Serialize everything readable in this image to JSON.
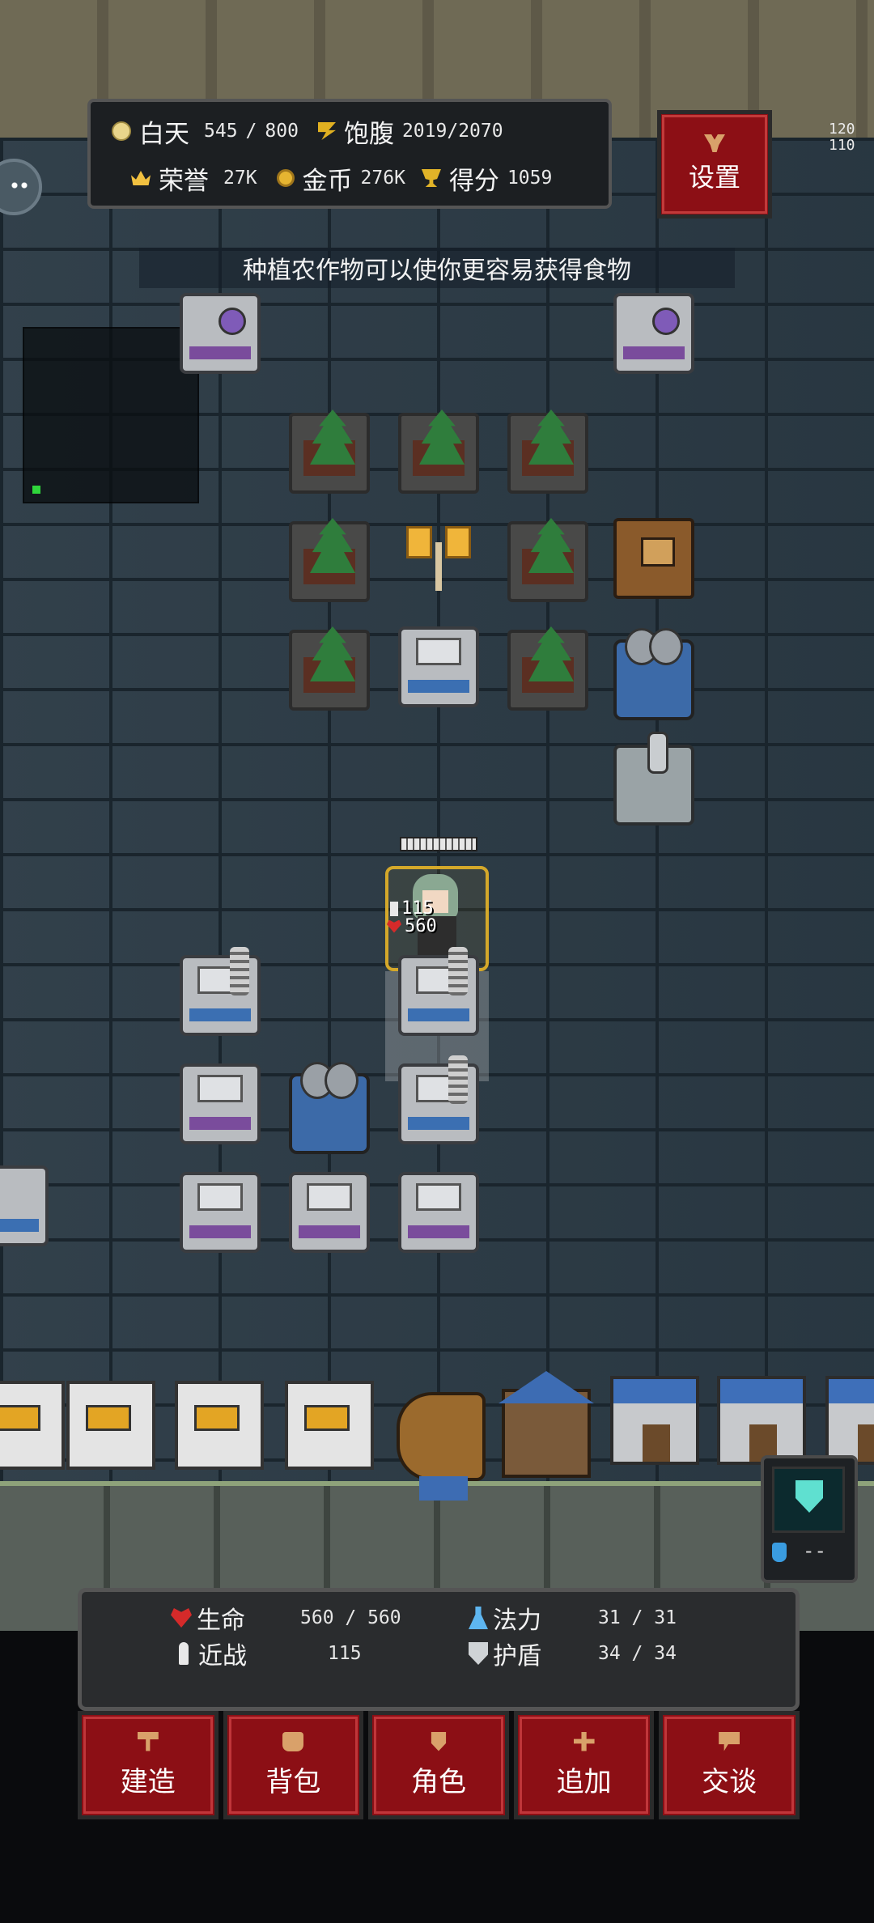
{
  "hud_top": {
    "daytime": {
      "label": "白天",
      "current": "545",
      "max": "800",
      "icon": "sun-icon"
    },
    "satiety": {
      "label": "饱腹",
      "value": "2019/2070",
      "icon": "food-icon"
    },
    "honor": {
      "label": "荣誉",
      "value": "27K",
      "icon": "crown-icon"
    },
    "gold": {
      "label": "金币",
      "value": "276K",
      "icon": "coin-icon"
    },
    "score": {
      "label": "得分",
      "value": "1059",
      "icon": "trophy-icon"
    }
  },
  "settings_button": {
    "label": "设置",
    "icon": "wrench-icon"
  },
  "tip": "种植农作物可以使你更容易获得食物",
  "right_edge": {
    "line1": "120",
    "line2": "110"
  },
  "player": {
    "attack": "115",
    "hp": "560"
  },
  "shield_widget": {
    "icon": "shield-icon",
    "potion_icon": "potion-icon",
    "value": "--"
  },
  "stats": {
    "hp": {
      "label": "生命",
      "value": "560 / 560",
      "icon": "heart-icon"
    },
    "mana": {
      "label": "法力",
      "value": "31 / 31",
      "icon": "flask-icon"
    },
    "melee": {
      "label": "近战",
      "value": "115",
      "icon": "sword-icon"
    },
    "shield": {
      "label": "护盾",
      "value": "34 / 34",
      "icon": "shield-icon"
    }
  },
  "menu": [
    {
      "label": "建造",
      "icon": "hammer-icon"
    },
    {
      "label": "背包",
      "icon": "bag-icon"
    },
    {
      "label": "角色",
      "icon": "character-icon"
    },
    {
      "label": "追加",
      "icon": "plus-icon"
    },
    {
      "label": "交谈",
      "icon": "speech-icon"
    }
  ]
}
